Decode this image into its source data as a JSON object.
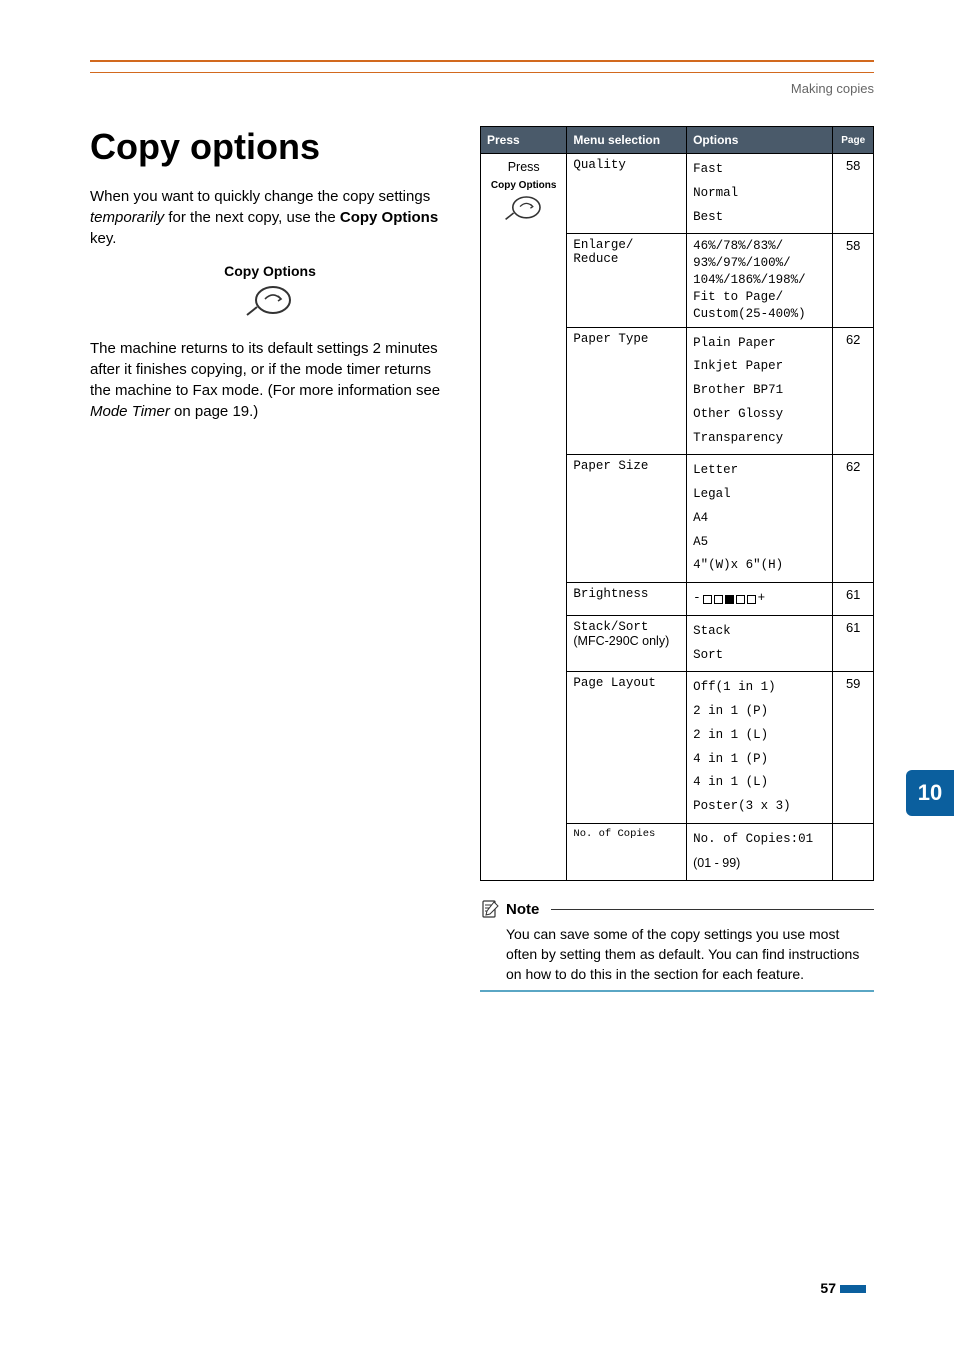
{
  "breadcrumb": "Making copies",
  "heading": "Copy options",
  "intro_1a": "When you want to quickly change the copy settings ",
  "intro_1b": "temporarily",
  "intro_1c": " for the next copy, use the ",
  "intro_1d": "Copy Options",
  "intro_1e": " key.",
  "icon_label": "Copy Options",
  "intro_2a": "The machine returns to its default settings 2 minutes after it finishes copying, or if the mode timer returns the machine to Fax mode. (For more information see ",
  "intro_2b": "Mode Timer",
  "intro_2c": " on page 19.)",
  "table": {
    "headers": {
      "press": "Press",
      "menu": "Menu selection",
      "options": "Options",
      "page": "Page"
    },
    "press_label": "Press",
    "press_sub": "Copy Options",
    "rows": [
      {
        "menu": "Quality",
        "opts": [
          "Fast",
          "Normal",
          "Best"
        ],
        "page": "58"
      },
      {
        "menu": "Enlarge/\nReduce",
        "opts_raw": "46%/78%/83%/\n93%/97%/100%/\n104%/186%/198%/\nFit to Page/\nCustom(25-400%)",
        "page": "58",
        "tight": true
      },
      {
        "menu": "Paper Type",
        "opts": [
          "Plain Paper",
          "Inkjet Paper",
          "Brother BP71",
          "Other Glossy",
          "Transparency"
        ],
        "page": "62"
      },
      {
        "menu": "Paper Size",
        "opts": [
          "Letter",
          "Legal",
          "A4",
          "A5",
          "4\"(W)x 6\"(H)"
        ],
        "page": "62"
      },
      {
        "menu": "Brightness",
        "brightness": true,
        "page": "61"
      },
      {
        "menu": "Stack/Sort",
        "menu_sub": "(MFC-290C only)",
        "opts": [
          "Stack",
          "Sort"
        ],
        "page": "61"
      },
      {
        "menu": "Page Layout",
        "opts": [
          "Off(1 in 1)",
          "2 in 1 (P)",
          "2 in 1 (L)",
          "4 in 1 (P)",
          "4 in 1 (L)",
          "Poster(3 x 3)"
        ],
        "page": "59"
      },
      {
        "menu": "No. of Copies",
        "menu_small": true,
        "opts": [
          "No. of Copies:01"
        ],
        "opts_extra": "(01 - 99)",
        "page": ""
      }
    ]
  },
  "note": {
    "title": "Note",
    "body": "You can save some of the copy settings you use most often by setting them as default. You can find instructions on how to do this in the section for each feature."
  },
  "tab_number": "10",
  "page_number": "57"
}
